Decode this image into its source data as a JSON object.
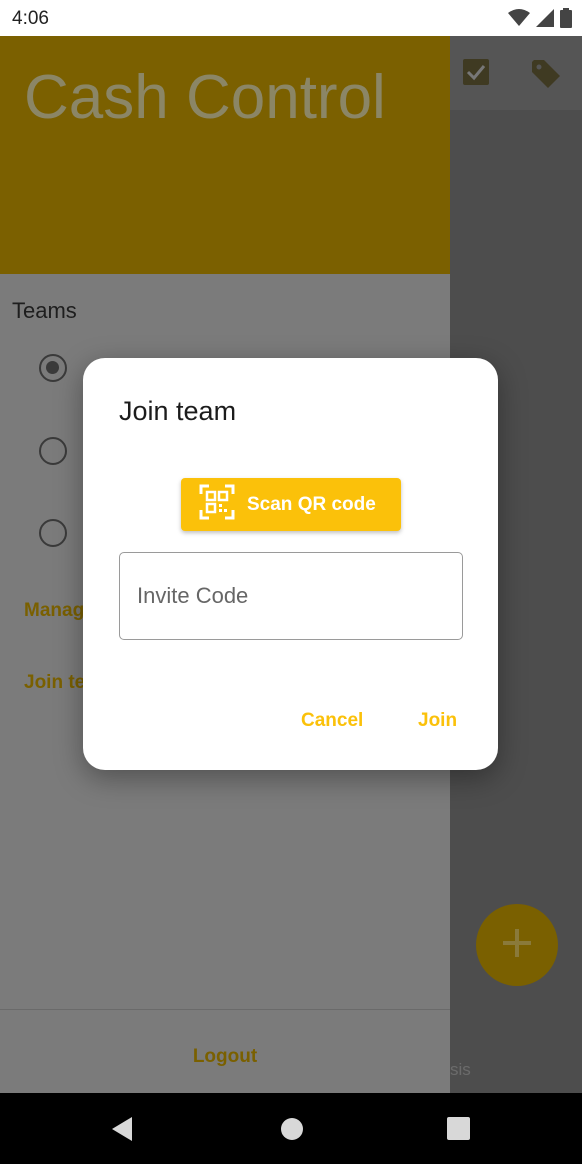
{
  "status_bar": {
    "time": "4:06",
    "icons": [
      "wifi-icon",
      "signal-icon",
      "battery-icon"
    ]
  },
  "app": {
    "toolbar_icons": [
      "checkbox-icon",
      "tag-icon"
    ],
    "fab_icon": "plus-icon",
    "bottom_nav_partial_text": "sis"
  },
  "drawer": {
    "title": "Cash Control",
    "teams_label": "Teams",
    "radios": [
      {
        "checked": true
      },
      {
        "checked": false
      },
      {
        "checked": false
      }
    ],
    "manage_link": "Manag",
    "join_link": "Join te",
    "logout_label": "Logout"
  },
  "dialog": {
    "title": "Join team",
    "scan_button_label": "Scan QR code",
    "scan_icon": "qr-scan-icon",
    "invite_code": {
      "value": "",
      "placeholder": "Invite Code"
    },
    "cancel_label": "Cancel",
    "join_label": "Join"
  },
  "nav_bar": {
    "buttons": [
      "back-icon",
      "home-icon",
      "recents-icon"
    ]
  },
  "colors": {
    "accent": "#fbc10a",
    "accent_dimmed": "#7a6000",
    "scrim": "#7b7b7b",
    "dialog_bg": "#ffffff"
  }
}
